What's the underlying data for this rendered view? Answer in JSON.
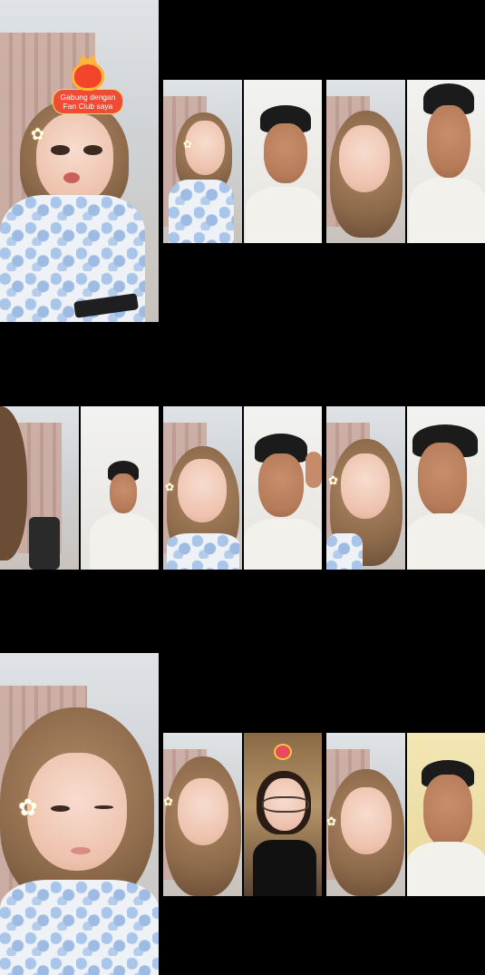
{
  "fan_club_badge": {
    "text": "Gabung dengan Fan Club saya"
  },
  "icons": {
    "badge": "heart-mascot-icon",
    "flower": "white-flower-icon"
  },
  "colors": {
    "background": "#000000",
    "badge_red": "#f04b35",
    "badge_gold": "#ffd35a"
  }
}
